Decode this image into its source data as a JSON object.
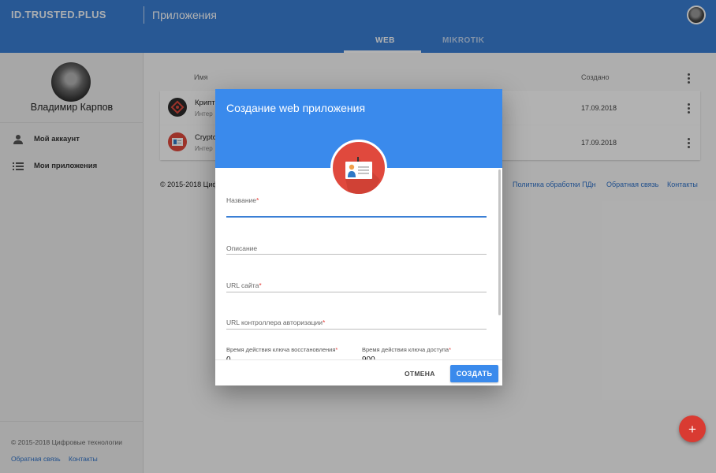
{
  "topbar": {
    "brand": "ID.TRUSTED.PLUS",
    "title": "Приложения",
    "tabs": [
      {
        "label": "WEB",
        "active": true
      },
      {
        "label": "MIKROTIK",
        "active": false
      }
    ]
  },
  "sidebar": {
    "username": "Владимир Карпов",
    "items": [
      {
        "label": "Мой аккаунт",
        "icon": "person-icon"
      },
      {
        "label": "Мои приложения",
        "icon": "list-icon"
      }
    ],
    "copyright": "© 2015-2018 Цифровые технологии",
    "links": {
      "feedback": "Обратная связь",
      "contacts": "Контакты"
    }
  },
  "main": {
    "columns": {
      "name": "Имя",
      "created": "Создано"
    },
    "rows": [
      {
        "name": "Крипт",
        "desc": "Интер",
        "date": "17.09.2018",
        "icon": "target-app-icon"
      },
      {
        "name": "Crypto",
        "desc": "Интер",
        "date": "17.09.2018",
        "icon": "id-card-app-icon"
      }
    ],
    "footer": {
      "copyright": "© 2015-2018 Циф",
      "privacy": "Политика обработки ПДн",
      "feedback": "Обратная связь",
      "contacts": "Контакты"
    }
  },
  "dialog": {
    "title": "Создание web приложения",
    "icon": "id-card-icon",
    "fields": {
      "name": {
        "label": "Название",
        "required": "*",
        "value": ""
      },
      "description": {
        "label": "Описание",
        "value": ""
      },
      "url": {
        "label": "URL сайта",
        "required": "*",
        "value": ""
      },
      "auth_url": {
        "label": "URL контроллера авторизации",
        "required": "*",
        "value": ""
      },
      "refresh_ttl": {
        "label": "Время действия ключа восстановления",
        "required": "*",
        "value": "0"
      },
      "access_ttl": {
        "label": "Время действия ключа доступа",
        "required": "*",
        "value": "900"
      }
    },
    "cancel_label": "ОТМЕНА",
    "create_label": "СОЗДАТЬ"
  },
  "fab": {
    "label": "+"
  },
  "colors": {
    "primary": "#3a7fd5",
    "dialog_header": "#3a8aec",
    "accent": "#d93b32",
    "required": "#e53935"
  }
}
